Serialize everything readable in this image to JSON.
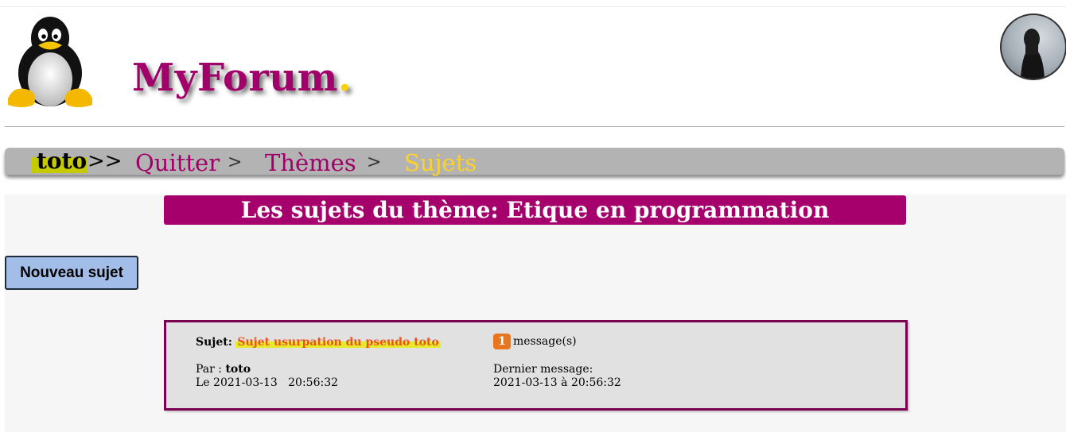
{
  "header": {
    "site_title": "MyForum",
    "site_title_dot": ".",
    "logo_icon": "tux-penguin-logo",
    "avatar_icon": "user-avatar"
  },
  "nav": {
    "user": "toto",
    "user_arrow": ">>",
    "quit_label": "Quitter",
    "sep1": ">",
    "themes_label": "Thèmes",
    "sep2": ">",
    "current_label": "Sujets"
  },
  "main": {
    "theme_title": "Les sujets du thème: Etique en programmation",
    "new_topic_label": "Nouveau sujet",
    "topics": [
      {
        "subject_label": "Sujet:",
        "subject_title": "Sujet usurpation du pseudo toto",
        "message_count": "1",
        "message_suffix": "message(s)",
        "author_prefix": "Par :",
        "author": "toto",
        "date_prefix": "Le",
        "date": "2021-03-13",
        "time": "20:56:32",
        "last_label": "Dernier message:",
        "last_value": "2021-03-13 à 20:56:32"
      }
    ]
  },
  "colors": {
    "brand": "#a1006a",
    "nav_bg": "#b3b3b3",
    "current": "#ffd22a",
    "button_bg": "#a3bde9",
    "badge": "#e8761f"
  }
}
